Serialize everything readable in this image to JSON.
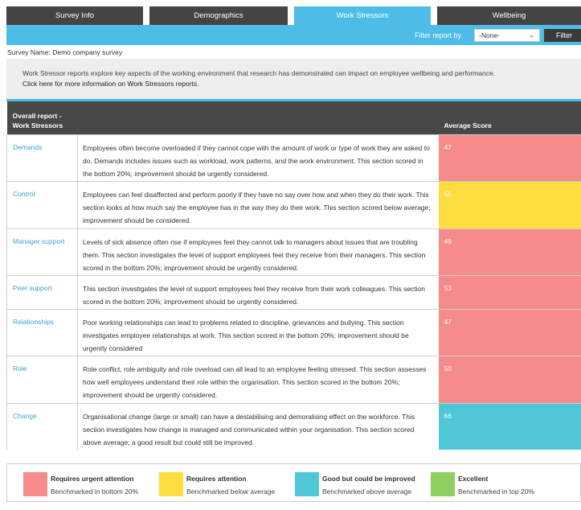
{
  "tabs": [
    {
      "label": "Survey Info",
      "active": false
    },
    {
      "label": "Demographics",
      "active": false
    },
    {
      "label": "Work Stressors",
      "active": true
    },
    {
      "label": "Wellbeing",
      "active": false
    }
  ],
  "filter": {
    "label": "Filter report by",
    "selected": "-None-",
    "button": "Filter"
  },
  "survey_name": "Survey Name: Demo company survey",
  "intro": {
    "text": "Work Stressor reports explore key aspects of the working environment that research has demonstrated can impact on employee wellbeing and performance.",
    "link": "Click here for more information on Work Stressors reports."
  },
  "table": {
    "header": {
      "title_line1": "Overall report -",
      "title_line2": "Work Stressors",
      "score": "Average Score"
    },
    "rows": [
      {
        "category": "Demands",
        "description": "Employees often become overloaded if they cannot cope with the amount of work or type of work they are asked to do. Demands includes issues such as workload, work patterns, and the work environment. This section scored in the bottom 20%; improvement should be urgently considered.",
        "score": "47",
        "status": "red"
      },
      {
        "category": "Control",
        "description": "Employees can feel disaffected and perform poorly if they have no say over how and when they do their work. This section looks at how much say the employee has in the way they do their work. This section scored below average; improvement should be considered.",
        "score": "55",
        "status": "yellow"
      },
      {
        "category": "Manager support",
        "description": "Levels of sick absence often rise if employees feel they cannot talk to managers about issues that are troubling them. This section investigates the level of support employees feel they receive from their managers. This section scored in the bottom 20%; improvement should be urgently considered.",
        "score": "49",
        "status": "red"
      },
      {
        "category": "Peer support",
        "description": "This section investigates the level of support employees feel they receive from their work colleagues. This section scored in the bottom 20%; improvement should be urgently considered.",
        "score": "53",
        "status": "red"
      },
      {
        "category": "Relationships",
        "description": "Poor working relationships can lead to problems related to discipline, grievances and bullying. This section investigates employee relationships at work. This section scored in the bottom 20%; improvement should be urgently considered",
        "score": "47",
        "status": "red"
      },
      {
        "category": "Role",
        "description": "Role conflict, role ambiguity and role overload can all lead to an employee feeling stressed. This section assesses how well employees understand their role within the organisation. This section scored in the bottom 20%; improvement should be urgently considered.",
        "score": "50",
        "status": "red"
      },
      {
        "category": "Change",
        "description": "Organisational change (large or small) can have a destabilising and demoralising effect on the workforce. This section investigates how change is managed and communicated within your organisation. This section scored above average; a good result but could still be improved.",
        "score": "66",
        "status": "blue"
      }
    ]
  },
  "legend": [
    {
      "title": "Requires urgent attention",
      "subtitle": "Benchmarked in bottom 20%",
      "color": "#f58b8b"
    },
    {
      "title": "Requires attention",
      "subtitle": "Benchmarked below average",
      "color": "#fddd3f"
    },
    {
      "title": "Good but could be improved",
      "subtitle": "Benchmarked above average",
      "color": "#4fc7d6"
    },
    {
      "title": "Excellent",
      "subtitle": "Benchmarked in top 20%",
      "color": "#8fcf5f"
    }
  ]
}
